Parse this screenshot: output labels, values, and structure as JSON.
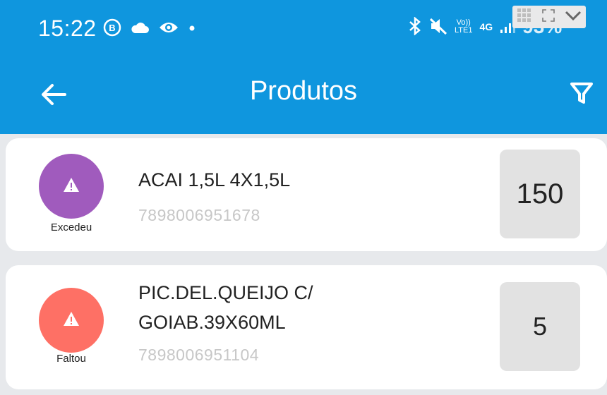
{
  "status_bar": {
    "time": "15:22",
    "left_icons": [
      "b-badge-icon",
      "cloud-icon",
      "eye-icon",
      "dot-icon"
    ],
    "right_icons": [
      "bluetooth-icon",
      "mute-icon",
      "volte-icon",
      "4g-icon",
      "signal-icon",
      "battery-icon"
    ],
    "network_label_1": "Vo))\nLTE1",
    "network_label_2": "4G",
    "battery_text": "93%"
  },
  "app_bar": {
    "title": "Produtos",
    "back_icon": "arrow-left-icon",
    "filter_icon": "filter-icon"
  },
  "colors": {
    "primary": "#0f96de",
    "excedeu": "#a05bbd",
    "faltou": "#fe7065",
    "qty_bg": "#e2e2e2",
    "code_gray": "#c7c7c7"
  },
  "products": [
    {
      "status": "Excedeu",
      "name": "ACAI 1,5L 4X1,5L",
      "code": "7898006951678",
      "quantity": "150"
    },
    {
      "status": "Faltou",
      "name_line1": "PIC.DEL.QUEIJO C/",
      "name_line2": "GOIAB.39X60ML",
      "code": "7898006951104",
      "quantity": "5"
    }
  ]
}
